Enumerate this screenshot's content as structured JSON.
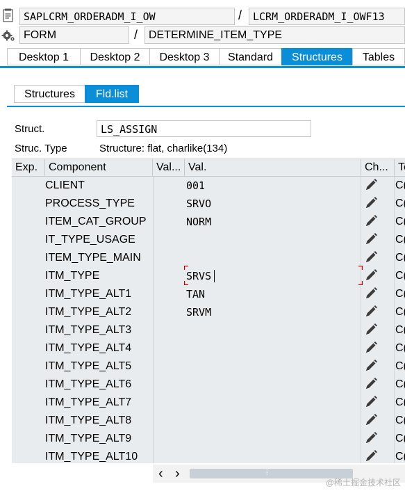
{
  "header": {
    "program": "SAPLCRM_ORDERADM_I_OW",
    "include": "LCRM_ORDERADM_I_OWF13",
    "type": "FORM",
    "name": "DETERMINE_ITEM_TYPE",
    "separator": "/"
  },
  "tabs": [
    {
      "label": "Desktop 1"
    },
    {
      "label": "Desktop 2"
    },
    {
      "label": "Desktop 3"
    },
    {
      "label": "Standard"
    },
    {
      "label": "Structures"
    },
    {
      "label": "Tables"
    }
  ],
  "active_tab": "Structures",
  "subtabs": [
    {
      "label": "Structures"
    },
    {
      "label": "Fld.list"
    }
  ],
  "active_subtab": "Fld.list",
  "struct": {
    "label": "Struct.",
    "value": "LS_ASSIGN",
    "type_label": "Struc. Type",
    "type_value": "Structure: flat, charlike(134)"
  },
  "grid": {
    "columns": [
      "Exp.",
      "Component",
      "Val...",
      "Val.",
      "Ch...",
      "Te"
    ],
    "rows": [
      {
        "component": "CLIENT",
        "value": "001",
        "tail": "C("
      },
      {
        "component": "PROCESS_TYPE",
        "value": "SRVO",
        "tail": "C("
      },
      {
        "component": "ITEM_CAT_GROUP",
        "value": "NORM",
        "tail": "C("
      },
      {
        "component": "IT_TYPE_USAGE",
        "value": "",
        "tail": "C("
      },
      {
        "component": "ITEM_TYPE_MAIN",
        "value": "",
        "tail": "C("
      },
      {
        "component": "ITM_TYPE",
        "value": "SRVS",
        "tail": "C("
      },
      {
        "component": "ITM_TYPE_ALT1",
        "value": "TAN",
        "tail": "C("
      },
      {
        "component": "ITM_TYPE_ALT2",
        "value": "SRVM",
        "tail": "C("
      },
      {
        "component": "ITM_TYPE_ALT3",
        "value": "",
        "tail": "C("
      },
      {
        "component": "ITM_TYPE_ALT4",
        "value": "",
        "tail": "C("
      },
      {
        "component": "ITM_TYPE_ALT5",
        "value": "",
        "tail": "C("
      },
      {
        "component": "ITM_TYPE_ALT6",
        "value": "",
        "tail": "C("
      },
      {
        "component": "ITM_TYPE_ALT7",
        "value": "",
        "tail": "C("
      },
      {
        "component": "ITM_TYPE_ALT8",
        "value": "",
        "tail": "C("
      },
      {
        "component": "ITM_TYPE_ALT9",
        "value": "",
        "tail": "C("
      },
      {
        "component": "ITM_TYPE_ALT10",
        "value": "",
        "tail": "C("
      }
    ],
    "scroll_left": "‹",
    "scroll_right": "›",
    "scroll_grip": "⦙"
  },
  "icons": {
    "source": "source-code-icon",
    "settings": "gear-icon",
    "change": "pencil-icon"
  },
  "colors": {
    "accent": "#0a8ed8",
    "grid_bg": "#e9ecef",
    "edit_marker": "#cc0000"
  },
  "watermark": "@稀土掘金技术社区"
}
